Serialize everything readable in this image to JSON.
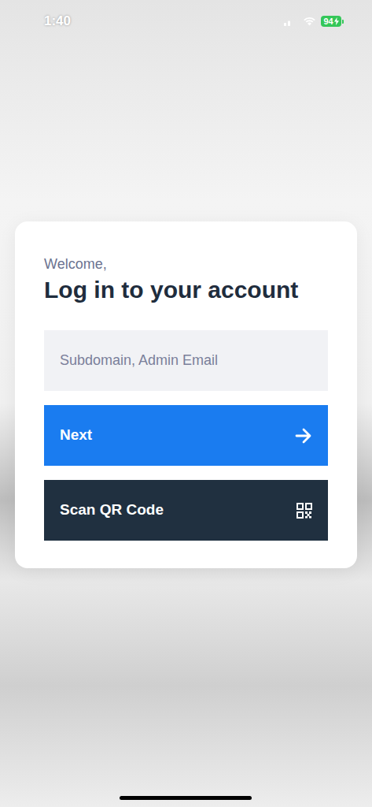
{
  "status_bar": {
    "time": "1:40",
    "battery": "94",
    "charging": true
  },
  "login": {
    "greeting": "Welcome,",
    "title": "Log in to your account",
    "field": {
      "placeholder": "Subdomain, Admin Email"
    },
    "buttons": [
      {
        "label": "Next",
        "kind": "primary"
      },
      {
        "label": "Scan QR Code",
        "kind": "secondary"
      }
    ]
  }
}
